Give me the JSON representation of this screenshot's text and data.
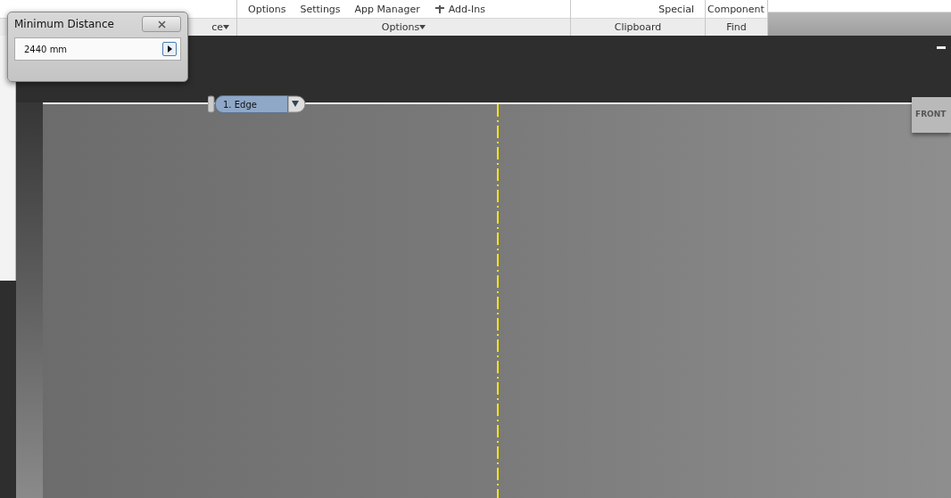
{
  "ribbon": {
    "commands": [
      {
        "label": "Options",
        "icon": false
      },
      {
        "label": "Settings",
        "icon": false
      },
      {
        "label": "App Manager",
        "icon": false
      },
      {
        "label": "Add-Ins",
        "icon": true
      }
    ],
    "clipboard_commands": [
      "Special"
    ],
    "find_commands": [
      "Component"
    ],
    "panels": [
      {
        "label": "ce",
        "dropdown": true
      },
      {
        "label": "Options",
        "dropdown": true
      },
      {
        "label": "Clipboard",
        "dropdown": false
      },
      {
        "label": "Find",
        "dropdown": false
      }
    ]
  },
  "dialog": {
    "title": "Minimum Distance",
    "value": "2440 mm"
  },
  "viewport": {
    "selection_tag": "1. Edge",
    "view_cube": "FRONT"
  }
}
